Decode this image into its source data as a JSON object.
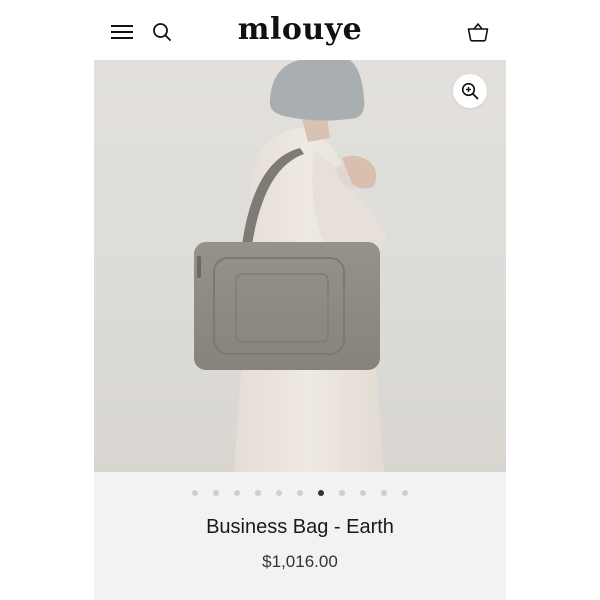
{
  "header": {
    "logo": "mlouye",
    "menu_icon": "hamburger-menu-icon",
    "search_icon": "search-icon",
    "cart_icon": "cart-basket-icon"
  },
  "gallery": {
    "zoom_icon": "zoom-in-icon",
    "slide_count": 11,
    "active_slide": 7
  },
  "product": {
    "title": "Business Bag - Earth",
    "price": "$1,016.00"
  },
  "colors": {
    "background": "#ffffff",
    "gallery_bg": "#dedbd7",
    "info_bg": "#f2f2f2",
    "bag": "#8f8c84",
    "coat": "#ece6e0",
    "hat": "#aab0b2",
    "dot_active": "#333333",
    "dot_inactive": "#cfcfcf"
  }
}
